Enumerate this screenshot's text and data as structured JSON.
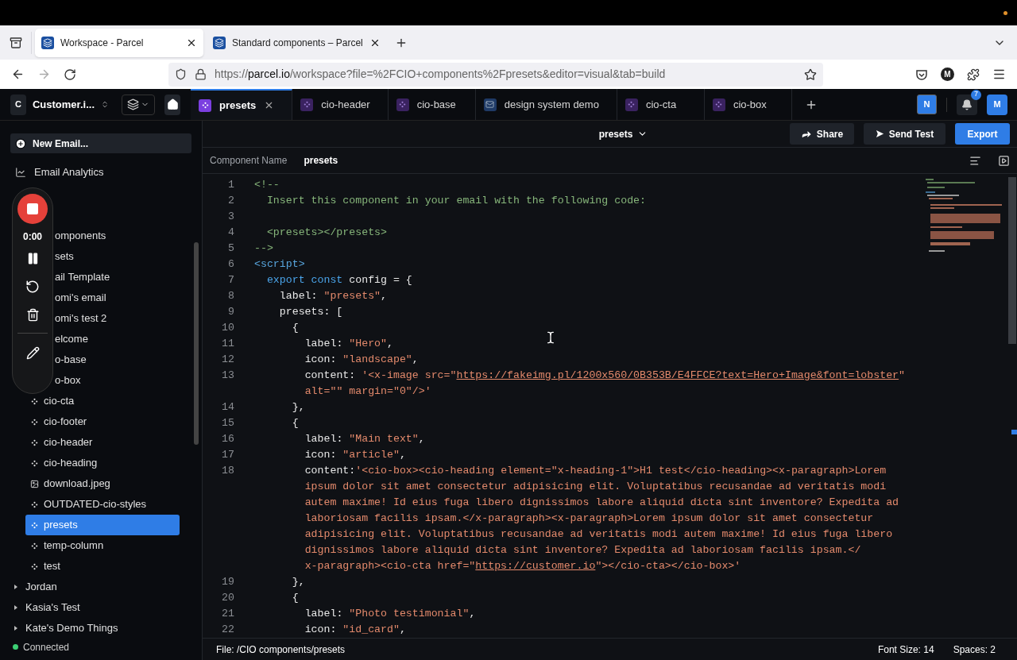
{
  "browser": {
    "tabs": [
      {
        "title": "Workspace - Parcel",
        "selected": true
      },
      {
        "title": "Standard components – Parcel",
        "selected": false
      }
    ],
    "url": {
      "scheme": "https://",
      "host": "parcel.io",
      "path": "/workspace?file=%2FCIO+components%2Fpresets&editor=visual&tab=build"
    },
    "profile_initial": "M"
  },
  "app": {
    "workspace_initial": "C",
    "workspace_name": "Customer.i...",
    "tabs": [
      {
        "label": "presets",
        "kind": "component",
        "selected": true
      },
      {
        "label": "cio-header",
        "kind": "component",
        "selected": false
      },
      {
        "label": "cio-base",
        "kind": "component",
        "selected": false
      },
      {
        "label": "design system demo",
        "kind": "email",
        "selected": false
      },
      {
        "label": "cio-cta",
        "kind": "component",
        "selected": false
      },
      {
        "label": "cio-box",
        "kind": "component",
        "selected": false
      }
    ],
    "user_badge": "N",
    "notification_count": "7",
    "avatar_initial": "M"
  },
  "sidebar": {
    "new_email": "New Email...",
    "analytics": "Email Analytics",
    "files": [
      {
        "label": "omponents",
        "kind": "covered",
        "selected": false
      },
      {
        "label": "sets",
        "kind": "covered",
        "selected": false
      },
      {
        "label": "ail Template",
        "kind": "covered",
        "selected": false
      },
      {
        "label": "omi's email",
        "kind": "covered",
        "selected": false
      },
      {
        "label": "omi's test 2",
        "kind": "covered",
        "selected": false
      },
      {
        "label": "elcome",
        "kind": "covered",
        "selected": false
      },
      {
        "label": "o-base",
        "kind": "covered",
        "selected": false
      },
      {
        "label": "o-box",
        "kind": "covered",
        "selected": false
      },
      {
        "label": "cio-cta",
        "kind": "component",
        "selected": false
      },
      {
        "label": "cio-footer",
        "kind": "component",
        "selected": false
      },
      {
        "label": "cio-header",
        "kind": "component",
        "selected": false
      },
      {
        "label": "cio-heading",
        "kind": "component",
        "selected": false
      },
      {
        "label": "download.jpeg",
        "kind": "image",
        "selected": false
      },
      {
        "label": "OUTDATED-cio-styles",
        "kind": "component",
        "selected": false
      },
      {
        "label": "presets",
        "kind": "component",
        "selected": true
      },
      {
        "label": "temp-column",
        "kind": "component",
        "selected": false
      },
      {
        "label": "test",
        "kind": "component",
        "selected": false
      }
    ],
    "folders": [
      {
        "label": "Jordan",
        "expanded": false
      },
      {
        "label": "Kasia's Test",
        "expanded": false
      },
      {
        "label": "Kate's Demo Things",
        "expanded": false
      }
    ],
    "connection": "Connected"
  },
  "recorder": {
    "time": "0:00"
  },
  "editor": {
    "title": "presets",
    "buttons": [
      {
        "label": "Share",
        "kind": "share"
      },
      {
        "label": "Send Test",
        "kind": "send"
      },
      {
        "label": "Export",
        "kind": "primary"
      }
    ],
    "name_label": "Component Name",
    "name_value": "presets",
    "lines": [
      {
        "number": "1",
        "rows": [
          {
            "tokens": [
              {
                "kind": "comment",
                "text": "<!--"
              }
            ]
          }
        ]
      },
      {
        "number": "2",
        "rows": [
          {
            "indent": "  ",
            "tokens": [
              {
                "kind": "comment",
                "text": "Insert this component in your email with the following code:"
              }
            ]
          }
        ]
      },
      {
        "number": "3"
      },
      {
        "number": "4",
        "rows": [
          {
            "indent": "  ",
            "tokens": [
              {
                "kind": "comment",
                "text": "<presets></presets>"
              }
            ]
          }
        ]
      },
      {
        "number": "5",
        "rows": [
          {
            "tokens": [
              {
                "kind": "comment",
                "text": "-->"
              }
            ]
          }
        ]
      },
      {
        "number": "6",
        "rows": [
          {
            "tokens": [
              {
                "kind": "tag",
                "text": "<script>"
              }
            ]
          }
        ]
      },
      {
        "number": "7",
        "rows": [
          {
            "indent": "  ",
            "tokens": [
              {
                "kind": "keyword",
                "text": "export const"
              },
              {
                "kind": "plain",
                "text": " config = {"
              }
            ]
          }
        ]
      },
      {
        "number": "8",
        "rows": [
          {
            "indent": "    ",
            "tokens": [
              {
                "kind": "plain",
                "text": "label: "
              },
              {
                "kind": "string",
                "text": "\"presets\""
              },
              {
                "kind": "plain",
                "text": ","
              }
            ]
          }
        ]
      },
      {
        "number": "9",
        "rows": [
          {
            "indent": "    ",
            "tokens": [
              {
                "kind": "plain",
                "text": "presets: ["
              }
            ]
          }
        ]
      },
      {
        "number": "10",
        "rows": [
          {
            "indent": "      ",
            "tokens": [
              {
                "kind": "plain",
                "text": "{"
              }
            ]
          }
        ]
      },
      {
        "number": "11",
        "rows": [
          {
            "indent": "        ",
            "tokens": [
              {
                "kind": "plain",
                "text": "label: "
              },
              {
                "kind": "string",
                "text": "\"Hero\""
              },
              {
                "kind": "plain",
                "text": ","
              }
            ]
          }
        ]
      },
      {
        "number": "12",
        "rows": [
          {
            "indent": "        ",
            "tokens": [
              {
                "kind": "plain",
                "text": "icon: "
              },
              {
                "kind": "string",
                "text": "\"landscape\""
              },
              {
                "kind": "plain",
                "text": ","
              }
            ]
          }
        ]
      },
      {
        "number": "13",
        "rows": [
          {
            "indent": "        ",
            "tokens": [
              {
                "kind": "plain",
                "text": "content: "
              },
              {
                "kind": "string",
                "text": "'<x-image src=\""
              },
              {
                "kind": "link",
                "text": "https://fakeimg.pl/1200x560/0B353B/E4FFCE?text=Hero+Image&font=lobster"
              },
              {
                "kind": "string",
                "text": "\""
              }
            ]
          },
          {
            "indent": "        ",
            "tokens": [
              {
                "kind": "string",
                "text": "alt=\"\" margin=\"0\"/>'"
              }
            ]
          }
        ]
      },
      {
        "number": "14",
        "rows": [
          {
            "indent": "      ",
            "tokens": [
              {
                "kind": "plain",
                "text": "},"
              }
            ]
          }
        ]
      },
      {
        "number": "15",
        "rows": [
          {
            "indent": "      ",
            "tokens": [
              {
                "kind": "plain",
                "text": "{"
              }
            ]
          }
        ]
      },
      {
        "number": "16",
        "rows": [
          {
            "indent": "        ",
            "tokens": [
              {
                "kind": "plain",
                "text": "label: "
              },
              {
                "kind": "string",
                "text": "\"Main text\""
              },
              {
                "kind": "plain",
                "text": ","
              }
            ]
          }
        ]
      },
      {
        "number": "17",
        "rows": [
          {
            "indent": "        ",
            "tokens": [
              {
                "kind": "plain",
                "text": "icon: "
              },
              {
                "kind": "string",
                "text": "\"article\""
              },
              {
                "kind": "plain",
                "text": ","
              }
            ]
          }
        ]
      },
      {
        "number": "18",
        "rows": [
          {
            "indent": "        ",
            "tokens": [
              {
                "kind": "plain",
                "text": "content:"
              },
              {
                "kind": "string",
                "text": "'<cio-box><cio-heading element=\"x-heading-1\">H1 test</cio-heading><x-paragraph>Lorem"
              }
            ]
          },
          {
            "indent": "        ",
            "tokens": [
              {
                "kind": "string",
                "text": "ipsum dolor sit amet consectetur adipisicing elit. Voluptatibus recusandae ad veritatis modi"
              }
            ]
          },
          {
            "indent": "        ",
            "tokens": [
              {
                "kind": "string",
                "text": "autem maxime! Id eius fuga libero dignissimos labore aliquid dicta sint inventore? Expedita ad"
              }
            ]
          },
          {
            "indent": "        ",
            "tokens": [
              {
                "kind": "string",
                "text": "laboriosam facilis ipsam.</x-paragraph><x-paragraph>Lorem ipsum dolor sit amet consectetur"
              }
            ]
          },
          {
            "indent": "        ",
            "tokens": [
              {
                "kind": "string",
                "text": "adipisicing elit. Voluptatibus recusandae ad veritatis modi autem maxime! Id eius fuga libero"
              }
            ]
          },
          {
            "indent": "        ",
            "tokens": [
              {
                "kind": "string",
                "text": "dignissimos labore aliquid dicta sint inventore? Expedita ad laboriosam facilis ipsam.</"
              }
            ]
          },
          {
            "indent": "        ",
            "tokens": [
              {
                "kind": "string",
                "text": "x-paragraph><cio-cta href=\""
              },
              {
                "kind": "link",
                "text": "https://customer.io"
              },
              {
                "kind": "string",
                "text": "\"></cio-cta></cio-box>'"
              }
            ]
          }
        ]
      },
      {
        "number": "19",
        "rows": [
          {
            "indent": "      ",
            "tokens": [
              {
                "kind": "plain",
                "text": "},"
              }
            ]
          }
        ]
      },
      {
        "number": "20",
        "rows": [
          {
            "indent": "      ",
            "tokens": [
              {
                "kind": "plain",
                "text": "{"
              }
            ]
          }
        ]
      },
      {
        "number": "21",
        "rows": [
          {
            "indent": "        ",
            "tokens": [
              {
                "kind": "plain",
                "text": "label: "
              },
              {
                "kind": "string",
                "text": "\"Photo testimonial\""
              },
              {
                "kind": "plain",
                "text": ","
              }
            ]
          }
        ]
      },
      {
        "number": "22",
        "rows": [
          {
            "indent": "        ",
            "tokens": [
              {
                "kind": "plain",
                "text": "icon: "
              },
              {
                "kind": "string",
                "text": "\"id_card\""
              },
              {
                "kind": "plain",
                "text": ","
              }
            ]
          }
        ]
      }
    ],
    "status": {
      "file": "File: /CIO components/presets",
      "font_size": "Font Size: 14",
      "spaces": "Spaces: 2"
    }
  }
}
